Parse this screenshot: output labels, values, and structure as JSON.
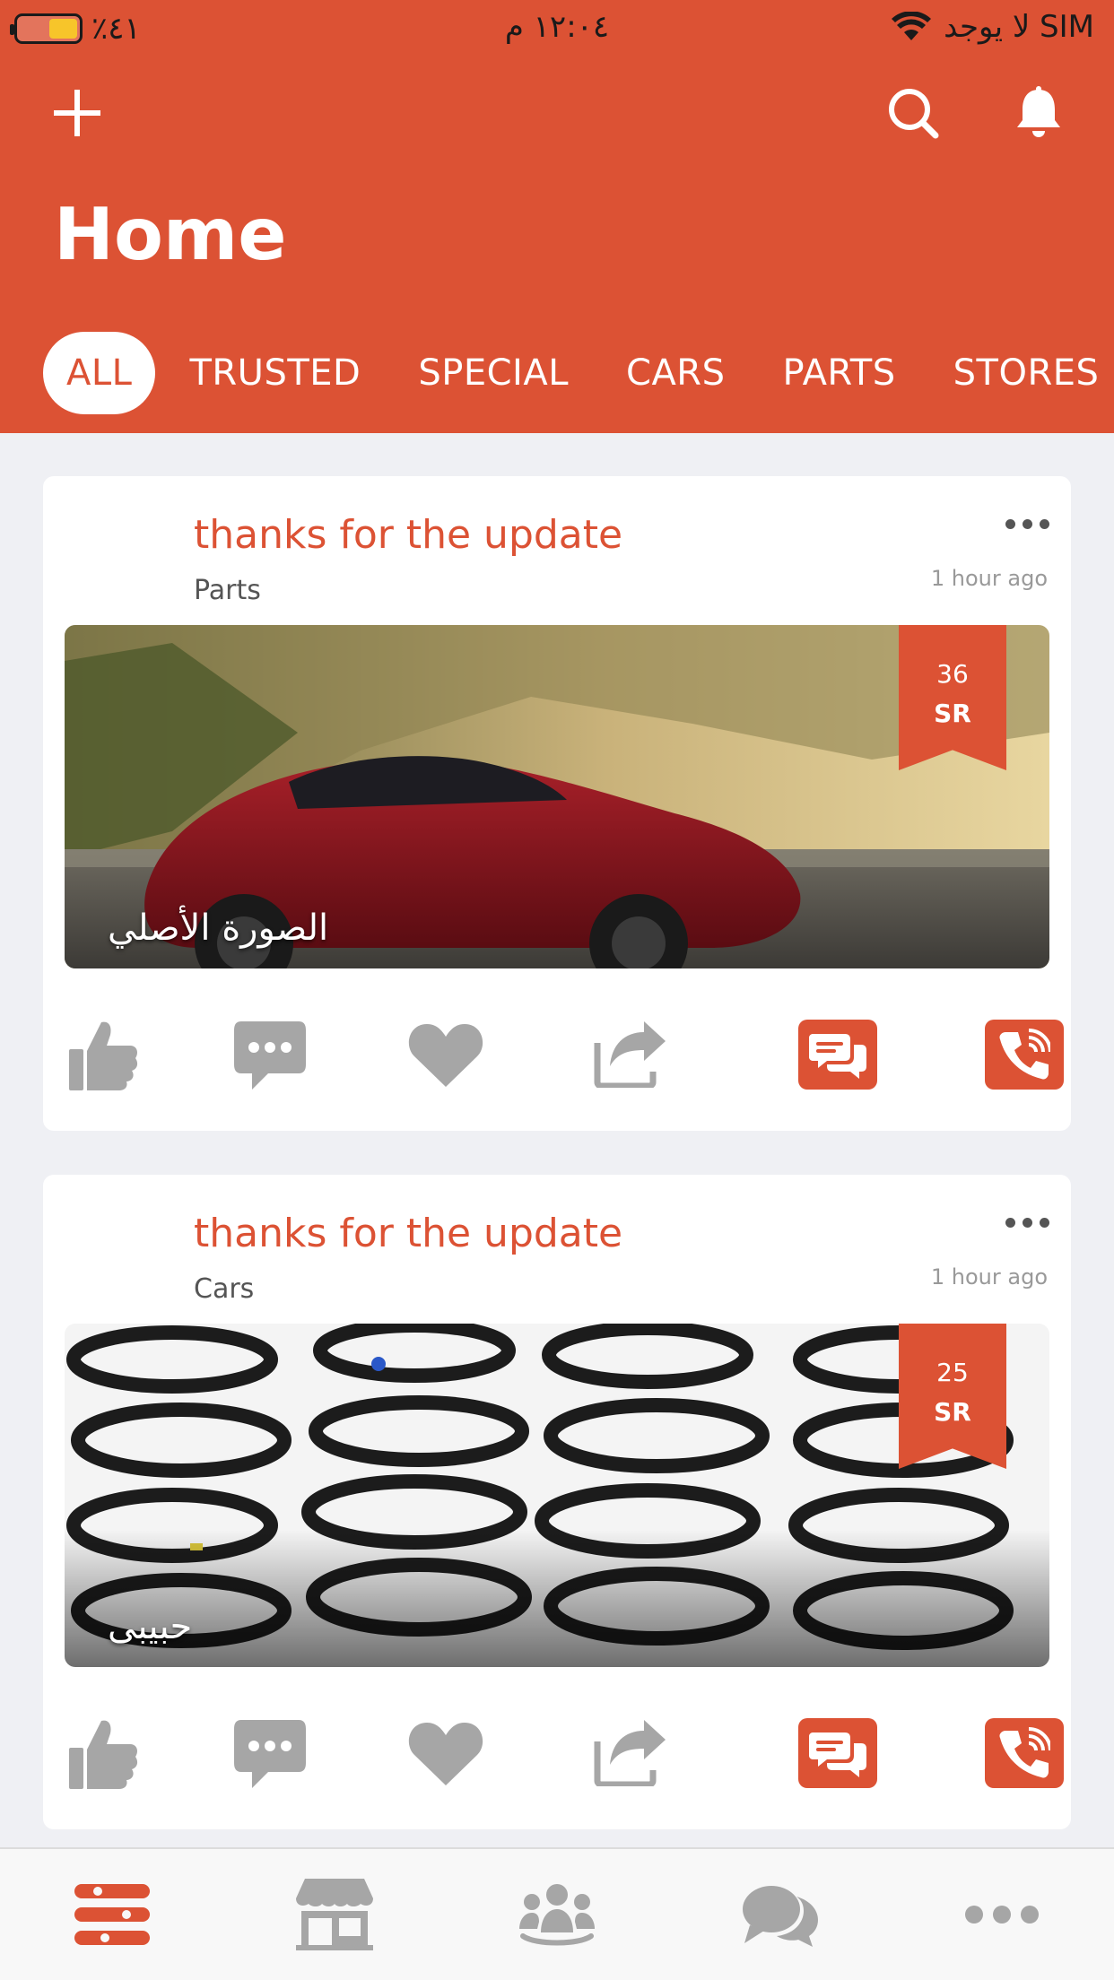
{
  "status_bar": {
    "battery": "٪٤١",
    "time": "١٢:٠٤ م",
    "carrier": "لا يوجد SIM"
  },
  "header": {
    "title": "Home",
    "icons": [
      "plus-icon",
      "search-icon",
      "bell-icon"
    ]
  },
  "tabs": [
    {
      "label": "ALL",
      "active": true
    },
    {
      "label": "TRUSTED",
      "active": false
    },
    {
      "label": "SPECIAL",
      "active": false
    },
    {
      "label": "CARS",
      "active": false
    },
    {
      "label": "PARTS",
      "active": false
    },
    {
      "label": "STORES",
      "active": false
    }
  ],
  "posts": [
    {
      "title": "thanks for the update",
      "category": "Parts",
      "time": "1 hour ago",
      "price": "36",
      "currency": "SR",
      "caption": "الصورة الأصلي",
      "image": "red-car-photo"
    },
    {
      "title": "thanks for the update",
      "category": "Cars",
      "time": "1 hour ago",
      "price": "25",
      "currency": "SR",
      "caption": "حبيبى",
      "image": "coil-springs-photo"
    }
  ],
  "post_actions": [
    "like-icon",
    "comment-icon",
    "favorite-icon",
    "share-icon",
    "chat-icon",
    "call-icon"
  ],
  "bottom_nav": [
    "feed-icon",
    "store-icon",
    "community-icon",
    "messages-icon",
    "more-icon"
  ],
  "colors": {
    "accent": "#dc5234",
    "background": "#eff0f4",
    "inactive_icon": "#a6a6a6"
  }
}
